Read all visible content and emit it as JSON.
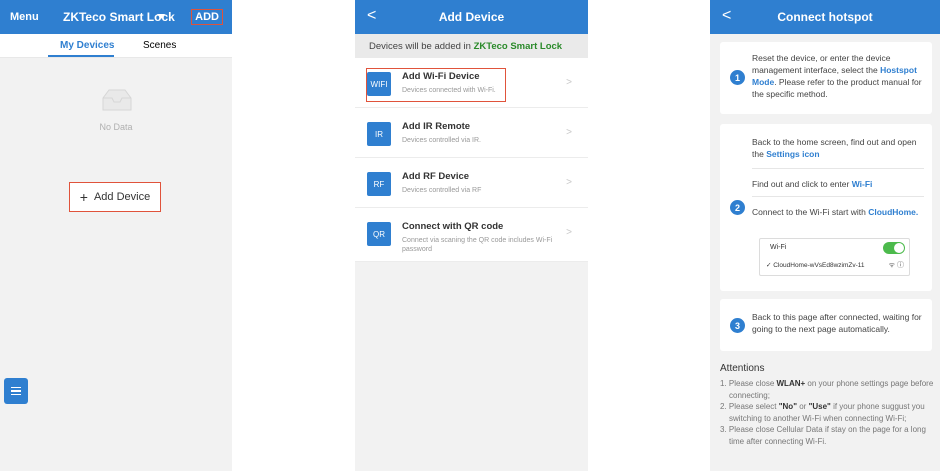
{
  "screen1": {
    "menu": "Menu",
    "title": "ZKTeco Smart Lock",
    "add": "ADD",
    "tabs": [
      "My Devices",
      "Scenes"
    ],
    "empty": "No Data",
    "add_device": "Add Device",
    "plus": "+"
  },
  "screen2": {
    "back": "<",
    "title": "Add Device",
    "added_prefix": "Devices will be added in",
    "added_target": "ZKTeco Smart Lock",
    "items": [
      {
        "icon": "WIFI",
        "title": "Add Wi-Fi Device",
        "sub": "Devices connected with Wi-Fi."
      },
      {
        "icon": "IR",
        "title": "Add IR Remote",
        "sub": "Devices controlled via IR."
      },
      {
        "icon": "RF",
        "title": "Add RF Device",
        "sub": "Devices controlled via RF"
      },
      {
        "icon": "QR",
        "title": "Connect with QR code",
        "sub": "Connect via scaning the QR code includes Wi-Fi password"
      }
    ],
    "chevron": ">"
  },
  "screen3": {
    "back": "<",
    "title": "Connect hotspot",
    "step1": {
      "num": "1",
      "t1": "Reset the device, or enter the device management interface, select the",
      "link": "Hostspot Mode",
      "t2": ". Please refer to the product manual for the specific method."
    },
    "step2": {
      "num": "2",
      "a1": "Back to the home screen, find out and open the",
      "a_link": "Settings icon",
      "b1": "Find out and click to enter",
      "b_link": "Wi-Fi",
      "c1": "Connect to the Wi-Fi start with",
      "c_link": "CloudHome",
      "wifi_label": "Wi-Fi",
      "network": "CloudHome-wVsEd8wzimZv-11",
      "check": "✓",
      "signal": "ᯤ ⓘ"
    },
    "step3": {
      "num": "3",
      "text": "Back to this page after connected, waiting for going to the next page automatically."
    },
    "attentions_title": "Attentions",
    "attentions": [
      {
        "n": "1.",
        "pre": "Please close",
        "bold": "WLAN+",
        "post": "on your phone settings page before connecting;"
      },
      {
        "n": "2.",
        "pre": "Please select",
        "bold": "\"No\"",
        "mid": "or",
        "bold2": "\"Use\"",
        "post": "if your phone suggust you switching to another Wi-Fi when connecting Wi-Fi;"
      },
      {
        "n": "3.",
        "pre": "Please close Cellular Data if stay on the page for a long time after connecting Wi-Fi."
      }
    ]
  },
  "colors": {
    "accent": "#2f7fd0",
    "highlight": "#e0533b",
    "green": "#2a8a2a"
  }
}
